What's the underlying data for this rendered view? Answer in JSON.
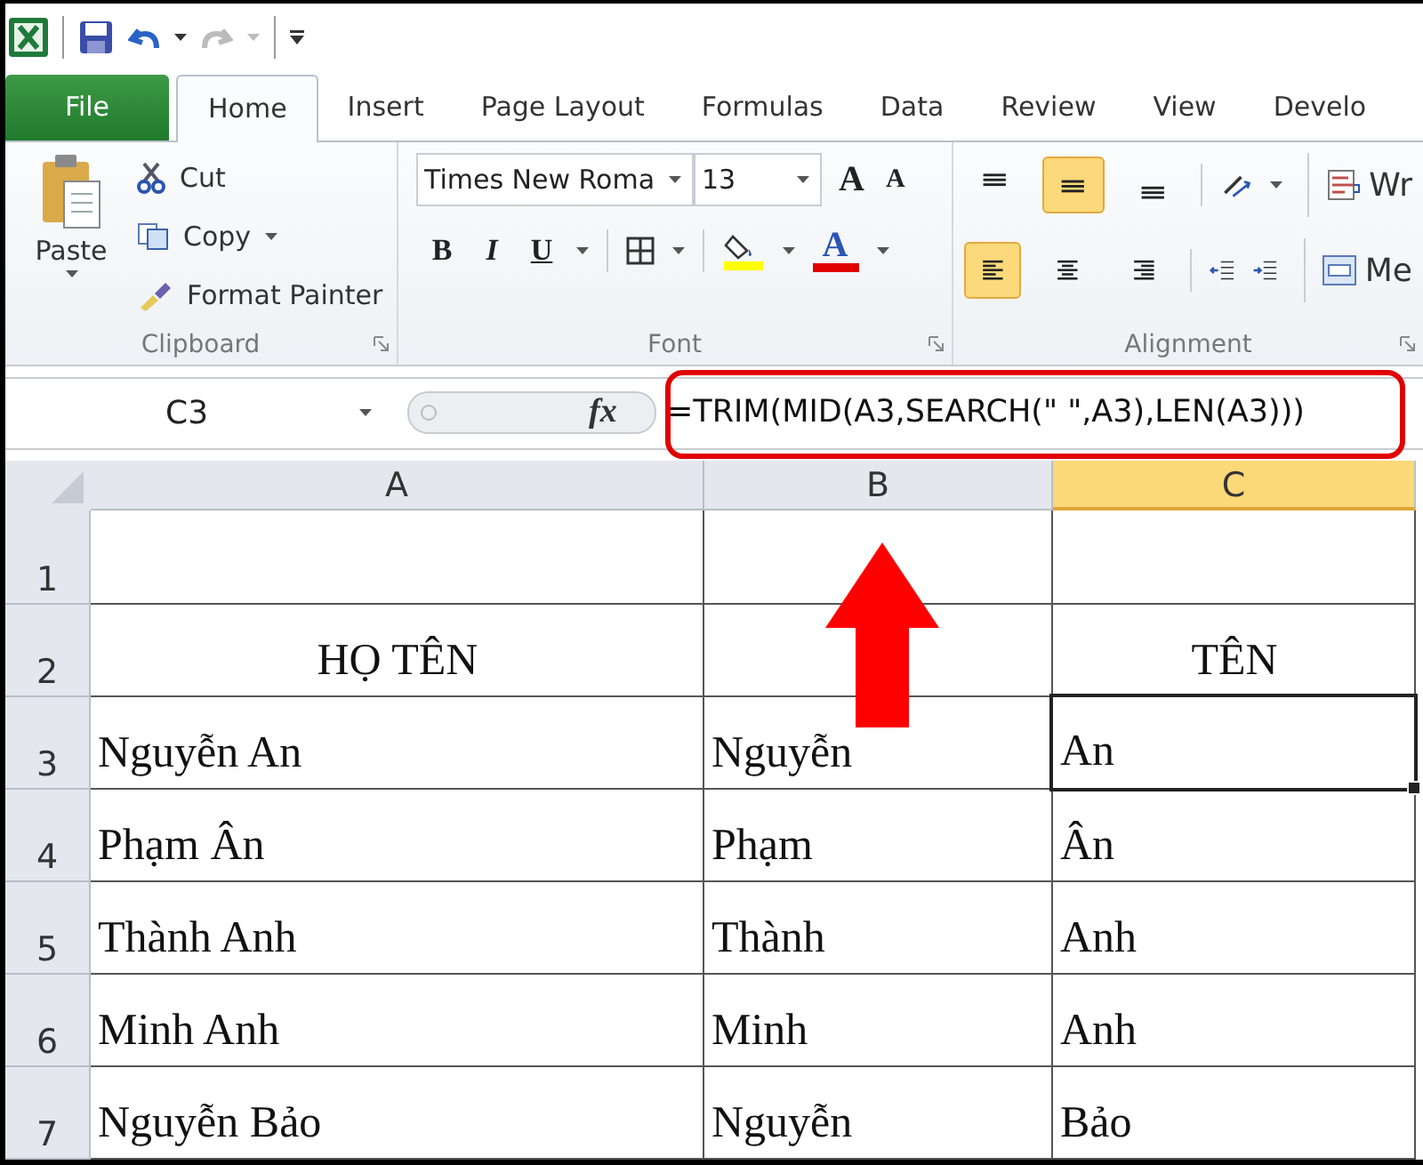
{
  "quick_access": [
    {
      "kind": "app"
    },
    {
      "kind": "save"
    },
    {
      "kind": "undo",
      "disabled": false
    },
    {
      "kind": "redo",
      "disabled": true
    },
    {
      "kind": "customize"
    }
  ],
  "tabs": [
    {
      "label": "File",
      "kind": "file",
      "selected": false
    },
    {
      "label": "Home",
      "kind": "tab",
      "selected": true
    },
    {
      "label": "Insert",
      "kind": "tab",
      "selected": false
    },
    {
      "label": "Page Layout",
      "kind": "tab",
      "selected": false
    },
    {
      "label": "Formulas",
      "kind": "tab",
      "selected": false
    },
    {
      "label": "Data",
      "kind": "tab",
      "selected": false
    },
    {
      "label": "Review",
      "kind": "tab",
      "selected": false
    },
    {
      "label": "View",
      "kind": "tab",
      "selected": false
    },
    {
      "label": "Develo",
      "kind": "tab",
      "selected": false
    }
  ],
  "clipboard": {
    "paste": "Paste",
    "buttons": [
      {
        "label": "Cut",
        "kind": "cut"
      },
      {
        "label": "Copy",
        "kind": "copy"
      },
      {
        "label": "Format Painter",
        "kind": "painter"
      }
    ],
    "group_label": "Clipboard"
  },
  "font": {
    "font_name": "Times New Roma",
    "font_size": "13",
    "grow": "A",
    "shrink": "A",
    "bold": "B",
    "italic": "I",
    "underline": "U",
    "color_letter": "A",
    "group_label": "Font"
  },
  "alignment": {
    "vertical": [
      {
        "kind": "top",
        "selected": false
      },
      {
        "kind": "middle",
        "selected": true
      },
      {
        "kind": "bottom",
        "selected": false
      }
    ],
    "horizontal": [
      {
        "kind": "left",
        "selected": true
      },
      {
        "kind": "center",
        "selected": false
      },
      {
        "kind": "right",
        "selected": false
      }
    ],
    "wrap": "Wr",
    "merge": "Me",
    "group_label": "Alignment"
  },
  "formula_bar": {
    "name_box": "C3",
    "function_label": "fx",
    "formula": "=TRIM(MID(A3,SEARCH(\" \",A3),LEN(A3)))"
  },
  "sheet": {
    "columns": [
      {
        "label": "A",
        "selected": false
      },
      {
        "label": "B",
        "selected": false
      },
      {
        "label": "C",
        "selected": true
      }
    ],
    "rows": [
      {
        "header": "1",
        "kind": "blank",
        "cells": []
      },
      {
        "header": "2",
        "kind": "heading",
        "cells": [
          {
            "text": "HỌ TÊN",
            "selected": false
          },
          {
            "selected": false
          },
          {
            "text": "TÊN",
            "selected": false
          }
        ]
      },
      {
        "header": "3",
        "kind": "data",
        "cells": [
          {
            "text": "Nguyễn An",
            "selected": false
          },
          {
            "text": "Nguyễn",
            "selected": false
          },
          {
            "text": "An",
            "selected": true
          }
        ]
      },
      {
        "header": "4",
        "kind": "data",
        "cells": [
          {
            "text": "Phạm Ân",
            "selected": false
          },
          {
            "text": "Phạm",
            "selected": false
          },
          {
            "text": "Ân",
            "selected": false
          }
        ]
      },
      {
        "header": "5",
        "kind": "data",
        "cells": [
          {
            "text": "Thành Anh",
            "selected": false
          },
          {
            "text": "Thành",
            "selected": false
          },
          {
            "text": "Anh",
            "selected": false
          }
        ]
      },
      {
        "header": "6",
        "kind": "data",
        "cells": [
          {
            "text": "Minh Anh",
            "selected": false
          },
          {
            "text": "Minh",
            "selected": false
          },
          {
            "text": "Anh",
            "selected": false
          }
        ]
      },
      {
        "header": "7",
        "kind": "data",
        "cells": [
          {
            "text": "Nguyễn Bảo",
            "selected": false
          },
          {
            "text": "Nguyễn",
            "selected": false
          },
          {
            "text": "Bảo",
            "selected": false
          }
        ]
      }
    ]
  },
  "annotations": {
    "frame": true,
    "arrow": true
  }
}
